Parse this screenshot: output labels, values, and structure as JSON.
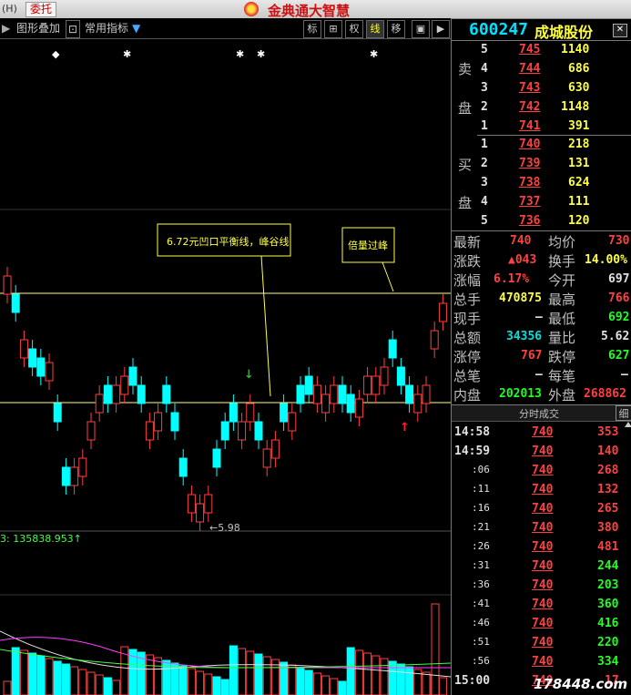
{
  "titlebar": {
    "left_tag": "(H)",
    "order_button": "委托",
    "brand": "金典通大智慧"
  },
  "toolbar": {
    "overlay_label": "图形叠加",
    "indicators_label": "常用指标",
    "buttons": [
      "标",
      "⊞",
      "权",
      "线",
      "移"
    ]
  },
  "stock": {
    "code": "600247",
    "name": "成城股份"
  },
  "sell_book": [
    {
      "level": "5",
      "price": "745",
      "volume": "1140"
    },
    {
      "level": "4",
      "price": "744",
      "volume": "686"
    },
    {
      "level": "3",
      "price": "743",
      "volume": "630"
    },
    {
      "level": "2",
      "price": "742",
      "volume": "1148"
    },
    {
      "level": "1",
      "price": "741",
      "volume": "391"
    }
  ],
  "buy_book": [
    {
      "level": "1",
      "price": "740",
      "volume": "218"
    },
    {
      "level": "2",
      "price": "739",
      "volume": "131"
    },
    {
      "level": "3",
      "price": "738",
      "volume": "624"
    },
    {
      "level": "4",
      "price": "737",
      "volume": "111"
    },
    {
      "level": "5",
      "price": "736",
      "volume": "120"
    }
  ],
  "sell_label": [
    "卖",
    "盘"
  ],
  "buy_label": [
    "买",
    "盘"
  ],
  "stats": {
    "latest_label": "最新",
    "latest": "740",
    "avg_label": "均价",
    "avg": "730",
    "change_label": "涨跌",
    "change": "▲043",
    "turnover_label": "换手",
    "turnover": "14.00%",
    "pct_label": "涨幅",
    "pct": "6.17%",
    "open_label": "今开",
    "open": "697",
    "vol_label": "总手",
    "vol": "470875",
    "high_label": "最高",
    "high": "766",
    "cur_label": "现手",
    "cur": "–",
    "low_label": "最低",
    "low": "692",
    "amount_label": "总额",
    "amount": "34356",
    "ratio_label": "量比",
    "ratio": "5.62",
    "limit_up_label": "涨停",
    "limit_up": "767",
    "limit_down_label": "跌停",
    "limit_down": "627",
    "trades_label": "总笔",
    "trades": "–",
    "per_trade_label": "每笔",
    "per_trade": "–",
    "inner_label": "内盘",
    "inner": "202013",
    "outer_label": "外盘",
    "outer": "268862"
  },
  "ticks_header": {
    "title": "分时成交",
    "detail": "细"
  },
  "ticks": [
    {
      "time": "14:58",
      "price": "740",
      "vol": "353",
      "dir": "red"
    },
    {
      "time": "14:59",
      "price": "740",
      "vol": "140",
      "dir": "red"
    },
    {
      "time": ":06",
      "price": "740",
      "vol": "268",
      "dir": "red"
    },
    {
      "time": ":11",
      "price": "740",
      "vol": "132",
      "dir": "red"
    },
    {
      "time": ":16",
      "price": "740",
      "vol": "265",
      "dir": "red"
    },
    {
      "time": ":21",
      "price": "740",
      "vol": "380",
      "dir": "red"
    },
    {
      "time": ":26",
      "price": "740",
      "vol": "481",
      "dir": "red"
    },
    {
      "time": ":31",
      "price": "740",
      "vol": "244",
      "dir": "green"
    },
    {
      "time": ":36",
      "price": "740",
      "vol": "203",
      "dir": "green"
    },
    {
      "time": ":41",
      "price": "740",
      "vol": "360",
      "dir": "green"
    },
    {
      "time": ":46",
      "price": "740",
      "vol": "416",
      "dir": "green"
    },
    {
      "time": ":51",
      "price": "740",
      "vol": "220",
      "dir": "green"
    },
    {
      "time": ":56",
      "price": "740",
      "vol": "334",
      "dir": "green"
    },
    {
      "time": "15:00",
      "price": "740",
      "vol": "17",
      "dir": "red"
    }
  ],
  "chart": {
    "annotation_1": "6.72元凹口平衡线，峰谷线",
    "annotation_2": "倍量过峰",
    "low_marker": "←5.98",
    "volume_readout": "3: 135838.953↑",
    "watermark": "178448.com"
  },
  "colors": {
    "up": "#ff4040",
    "down": "#00ffff",
    "accent_line": "#ffff80",
    "ma_white": "#e0e0e0",
    "ma_magenta": "#ff40ff",
    "ma_green": "#40ff40"
  },
  "chart_data": {
    "type": "candlestick",
    "y_axis_hidden": true,
    "balance_line_price": 6.72,
    "low_marker_price": 5.98,
    "candles_dir": [
      "up",
      "down",
      "up",
      "down",
      "down",
      "up",
      "down",
      "down",
      "up",
      "up",
      "up",
      "up",
      "down",
      "up",
      "up",
      "down",
      "down",
      "up",
      "up",
      "down",
      "down",
      "down",
      "up",
      "up",
      "up",
      "down",
      "down",
      "down",
      "up",
      "up",
      "down",
      "up",
      "up",
      "down",
      "up",
      "down",
      "down",
      "up",
      "up",
      "up",
      "down",
      "down",
      "up",
      "up",
      "up",
      "up",
      "down",
      "down",
      "down",
      "up",
      "up",
      "up",
      "up"
    ]
  }
}
